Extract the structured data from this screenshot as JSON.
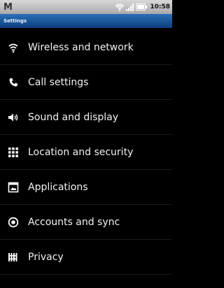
{
  "status_bar": {
    "notification_icon": "gmail-icon",
    "notification_glyph": "M",
    "icons": [
      "wifi-icon",
      "signal-icon",
      "battery-icon"
    ],
    "time": "10:58"
  },
  "header": {
    "title": "Settings"
  },
  "settings": {
    "items": [
      {
        "label": "Wireless and network",
        "icon": "wifi-icon"
      },
      {
        "label": "Call settings",
        "icon": "phone-icon"
      },
      {
        "label": "Sound and display",
        "icon": "speaker-icon"
      },
      {
        "label": "Location and security",
        "icon": "grid-icon"
      },
      {
        "label": "Applications",
        "icon": "applications-icon"
      },
      {
        "label": "Accounts and sync",
        "icon": "sync-icon"
      },
      {
        "label": "Privacy",
        "icon": "privacy-icon"
      }
    ]
  }
}
